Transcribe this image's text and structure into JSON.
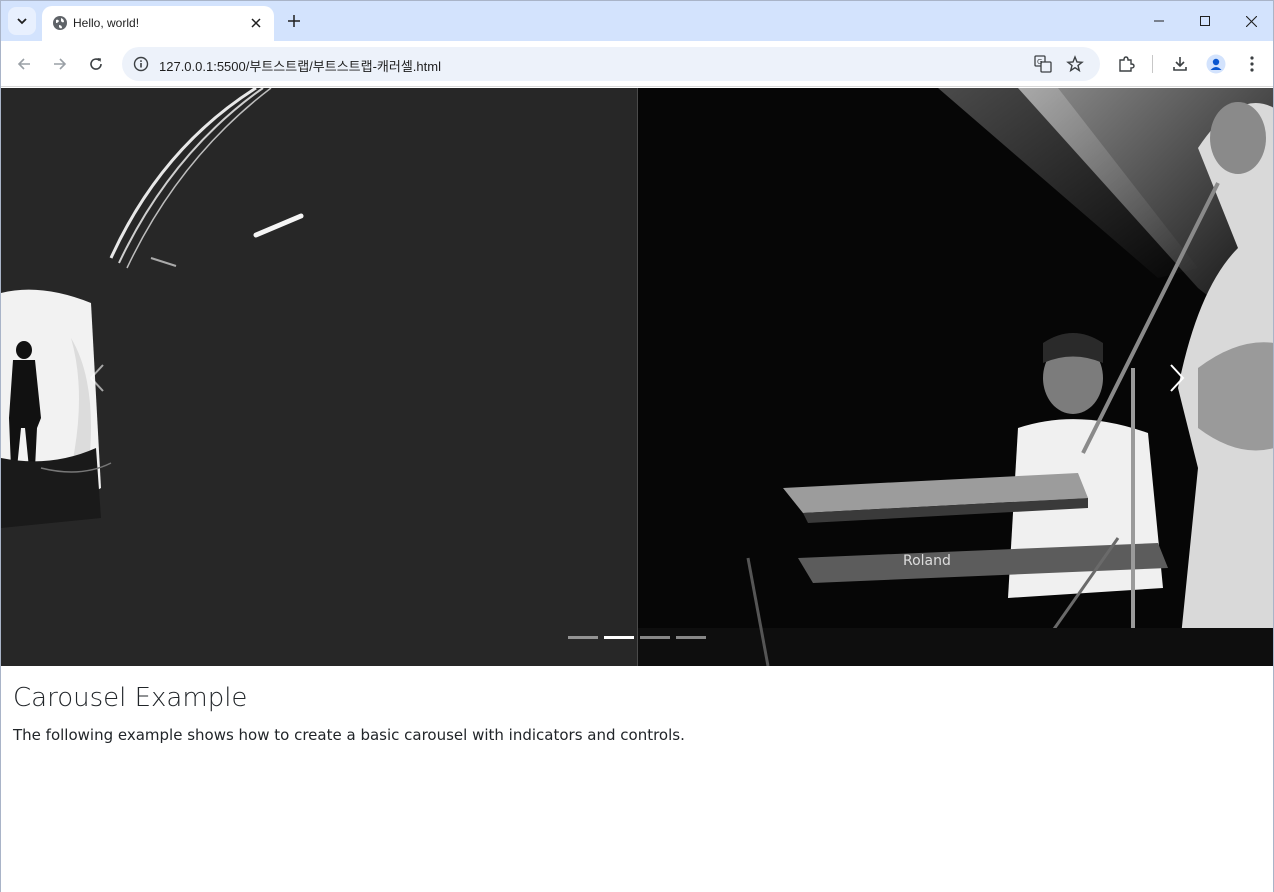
{
  "browser": {
    "tab_title": "Hello, world!",
    "url": "127.0.0.1:5500/부트스트랩/부트스트랩-캐러셀.html"
  },
  "carousel": {
    "slides": [
      "tunnel-silhouette-photo",
      "band-concert-photo"
    ],
    "active_indicator": 1,
    "indicator_count": 4
  },
  "content": {
    "heading": "Carousel Example",
    "paragraph": "The following example shows how to create a basic carousel with indicators and controls."
  },
  "colors": {
    "tabstrip": "#d3e3fd",
    "omnibox": "#edf2fa",
    "text": "#212529"
  }
}
